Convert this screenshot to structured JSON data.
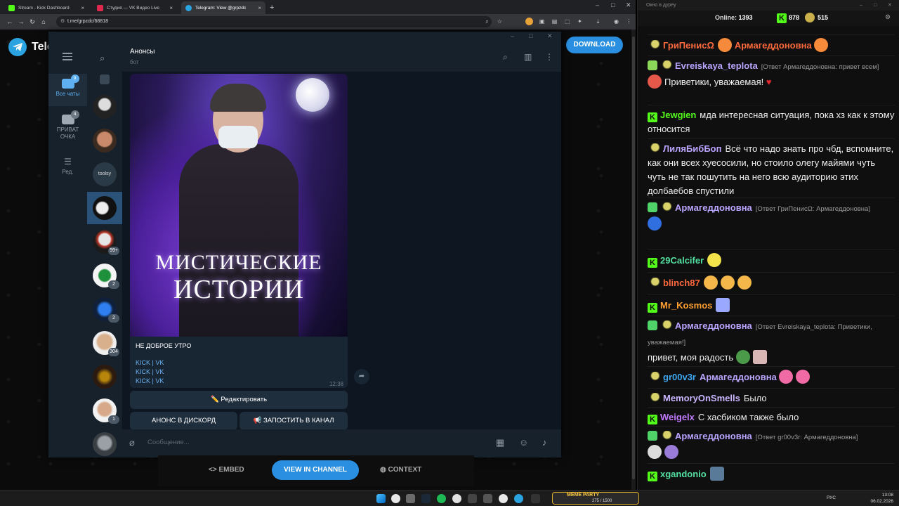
{
  "browser": {
    "tabs": [
      {
        "title": "Stream - Kick Dashboard",
        "color": "#53fc18"
      },
      {
        "title": "Студия — VK Видео Live",
        "color": "#e0284f"
      },
      {
        "title": "Telegram: View @grpzdc",
        "color": "#2aa3e0"
      }
    ],
    "url": "t.me/grpzdc/68818"
  },
  "telegram_web": {
    "logo_text": "Tele",
    "download_label": "DOWNLOAD",
    "embed_label": "EMBED",
    "view_in_channel_label": "VIEW IN CHANNEL",
    "context_label": "CONTEXT"
  },
  "tg_app": {
    "folders": [
      {
        "label": "Все чаты",
        "badge": "9"
      },
      {
        "label": "ПРИВАТ ОЧКА",
        "badge": "4"
      },
      {
        "label": "Ред.",
        "badge": ""
      }
    ],
    "chat_badges": [
      "99+",
      "2",
      "2",
      "304",
      "1"
    ],
    "avatar_text": "toolsy",
    "chat": {
      "title": "Анонсы",
      "subtitle": "бот",
      "poster_title_line1": "МИСТИЧЕСКИЕ",
      "poster_title_line2": "ИСТОРИИ",
      "message_text": "НЕ ДОБРОЕ УТРО",
      "links": [
        {
          "a": "KICK",
          "sep": " | ",
          "b": "VK"
        },
        {
          "a": "KICK",
          "sep": " | ",
          "b": "VK"
        },
        {
          "a": "KICK",
          "sep": " | ",
          "b": "VK"
        }
      ],
      "time": "12:38",
      "buttons": {
        "edit": "✏️ Редактировать",
        "discord": "АНОНС В ДИСКОРД",
        "post": "📢 ЗАПОСТИТЬ В КАНАЛ"
      },
      "composer_placeholder": "Сообщение..."
    }
  },
  "kick": {
    "window_title": "Окно в дуреу",
    "online_label": "Online:",
    "online_count": "1393",
    "stat1": "878",
    "stat2": "515",
    "messages": [
      {
        "user": "ГриПенисΩ",
        "color": "#ff6a3d",
        "text": "Армагеддоновна",
        "text_color": "#ff6a3d",
        "reply": ""
      },
      {
        "user": "Evreiskaya_teplota",
        "color": "#b9a4ff",
        "text": "Приветики, уважаемая!",
        "text_color": "#eee",
        "reply": "[Ответ Армагеддоновна: привет всем]"
      },
      {
        "user": "Jewgien",
        "color": "#53fc18",
        "text": "мда интересная ситуация, пока хз как к этому относится",
        "text_color": "#eee",
        "reply": ""
      },
      {
        "user": "ЛиляБибБоп",
        "color": "#b9a4ff",
        "text": "Всё что надо знать про чбд, вспомните, как они всех хуесосили, но стоило олегу майями чуть чуть не так пошутить на него всю аудиторию этих долбаебов спустили",
        "text_color": "#eee",
        "reply": ""
      },
      {
        "user": "Армагеддоновна",
        "color": "#b9a4ff",
        "text": "",
        "text_color": "#eee",
        "reply": "[Ответ ГриПенисΩ: Армагеддоновна]"
      },
      {
        "user": "29Calcifer",
        "color": "#53e0a0",
        "text": "",
        "text_color": "#eee",
        "reply": ""
      },
      {
        "user": "blinch87",
        "color": "#ff6a3d",
        "text": "",
        "text_color": "#eee",
        "reply": ""
      },
      {
        "user": "Mr_Kosmos",
        "color": "#ff9f2e",
        "text": "",
        "text_color": "#eee",
        "reply": ""
      },
      {
        "user": "Армагеддоновна",
        "color": "#b9a4ff",
        "text": "привет, моя радость",
        "text_color": "#eee",
        "reply": "[Ответ Evreiskaya_teplota: Приветики, уважаемая!]"
      },
      {
        "user": "gr00v3r",
        "color": "#3fa9f5",
        "text": "Армагеддоновна",
        "text_color": "#b9a4ff",
        "reply": ""
      },
      {
        "user": "MemoryOnSmells",
        "color": "#c9b6ff",
        "text": "Было",
        "text_color": "#eee",
        "reply": ""
      },
      {
        "user": "Weigelx",
        "color": "#c07bff",
        "text": "С хасбиком также было",
        "text_color": "#eee",
        "reply": ""
      },
      {
        "user": "Армагеддоновна",
        "color": "#b9a4ff",
        "text": "",
        "text_color": "#eee",
        "reply": "[Ответ gr00v3r: Армагеддоновна]"
      },
      {
        "user": "xgandonio",
        "color": "#53e0a0",
        "text": "",
        "text_color": "#eee",
        "reply": ""
      }
    ]
  },
  "taskbar": {
    "tray_lang": "РУС",
    "time": "13:08",
    "date": "06.02.2026",
    "media_label": "MEME PARTY",
    "media_counter": "275 / 1500"
  }
}
